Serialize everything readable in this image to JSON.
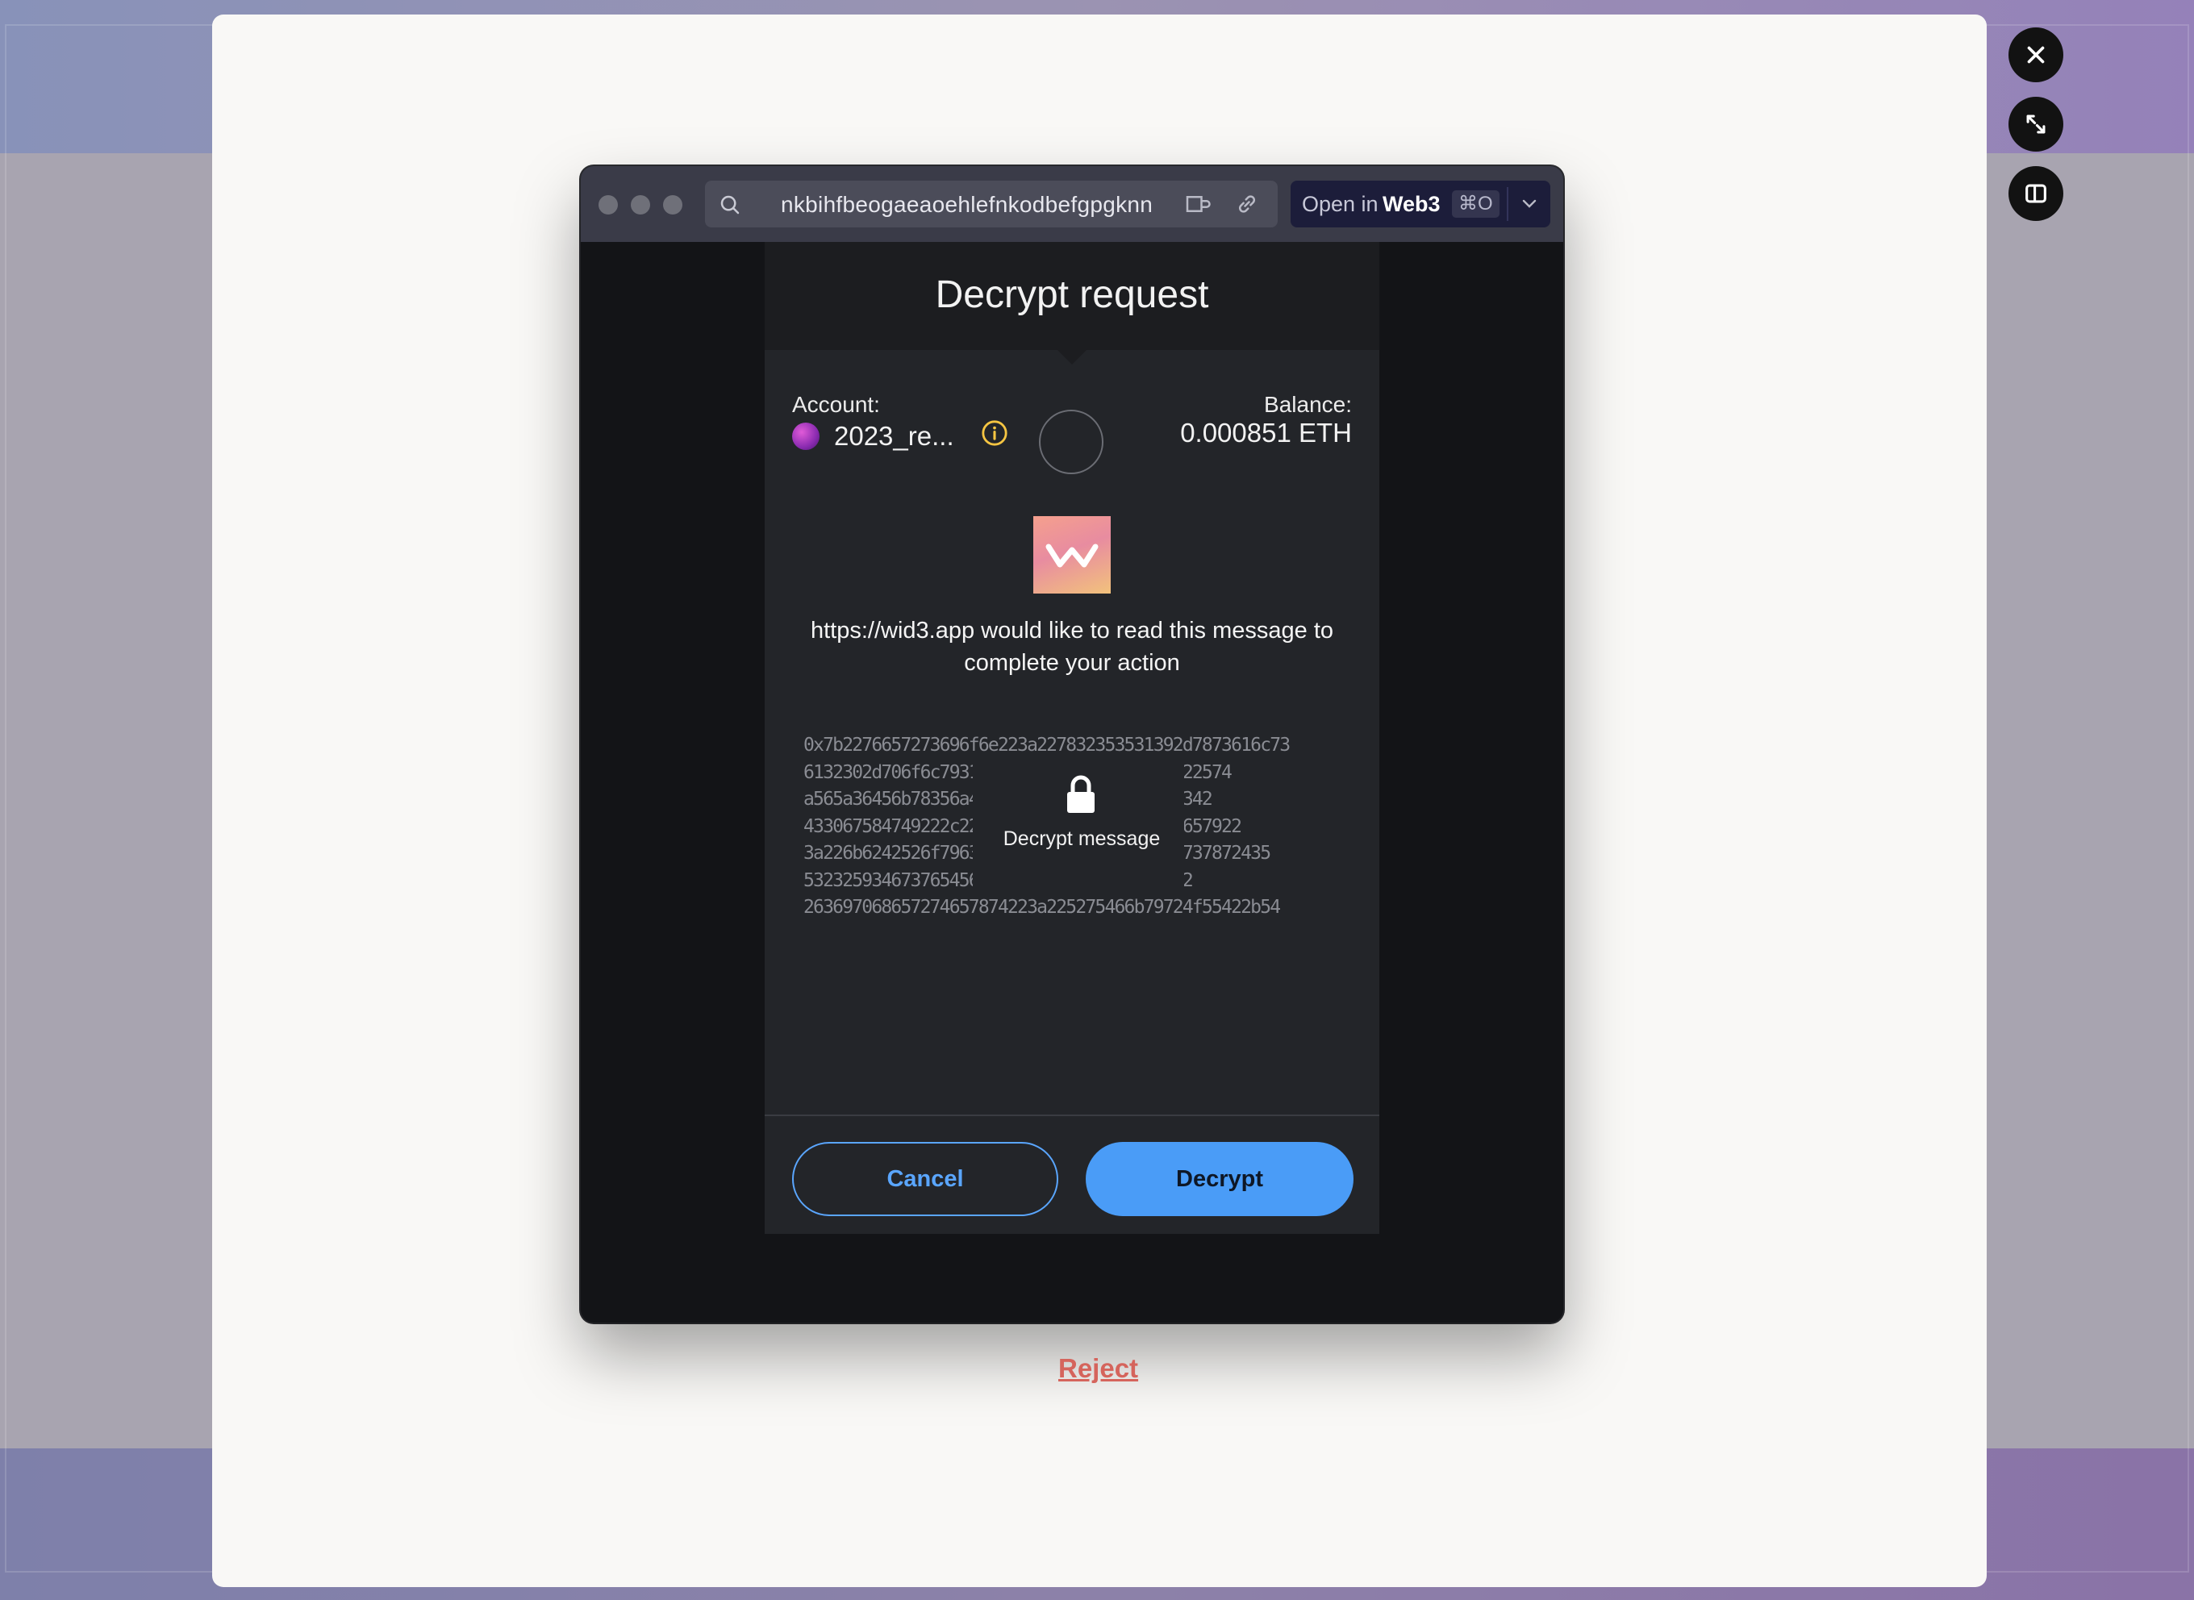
{
  "browser": {
    "url": "nkbihfbeogaeaoehlefnkodbefgpgknn",
    "open_in_label": "Open in",
    "open_in_target": "Web3",
    "open_in_shortcut": "⌘O"
  },
  "dialog": {
    "title": "Decrypt request",
    "account_label": "Account:",
    "account_name": "2023_re...",
    "balance_label": "Balance:",
    "balance_value": "0.000851 ETH",
    "request_text": "https://wid3.app would like to read this message to complete your action",
    "encrypted_lines": [
      "0x7b2276657273696f6e223a227832353531392d7873616c73",
      "6132302d706f6c793133303531363536365223a22574",
      "a565a36456b78356a4e354a6b4f56b4f5667494342",
      "433067584749222c226e6f6e6365223ac69634b657922",
      "3a226b6242526f79636b5a6f4e476f336a36a64737872435",
      "5323259346737654566577a46573443303d222c2",
      "263697068657274657874223a225275466b79724f55422b54"
    ],
    "decrypt_message_label": "Decrypt message",
    "cancel_label": "Cancel",
    "decrypt_label": "Decrypt"
  },
  "page": {
    "reject_label": "Reject"
  },
  "colors": {
    "accent": "#4a9cf7",
    "reject": "#d5645c",
    "info": "#f5c542"
  },
  "icons": {
    "close": "close-icon",
    "expand": "expand-icon",
    "split": "split-view-icon",
    "search": "search-icon",
    "extension": "extension-icon",
    "link": "link-icon",
    "chevron": "chevron-down-icon",
    "info": "info-icon",
    "lock": "lock-icon"
  }
}
